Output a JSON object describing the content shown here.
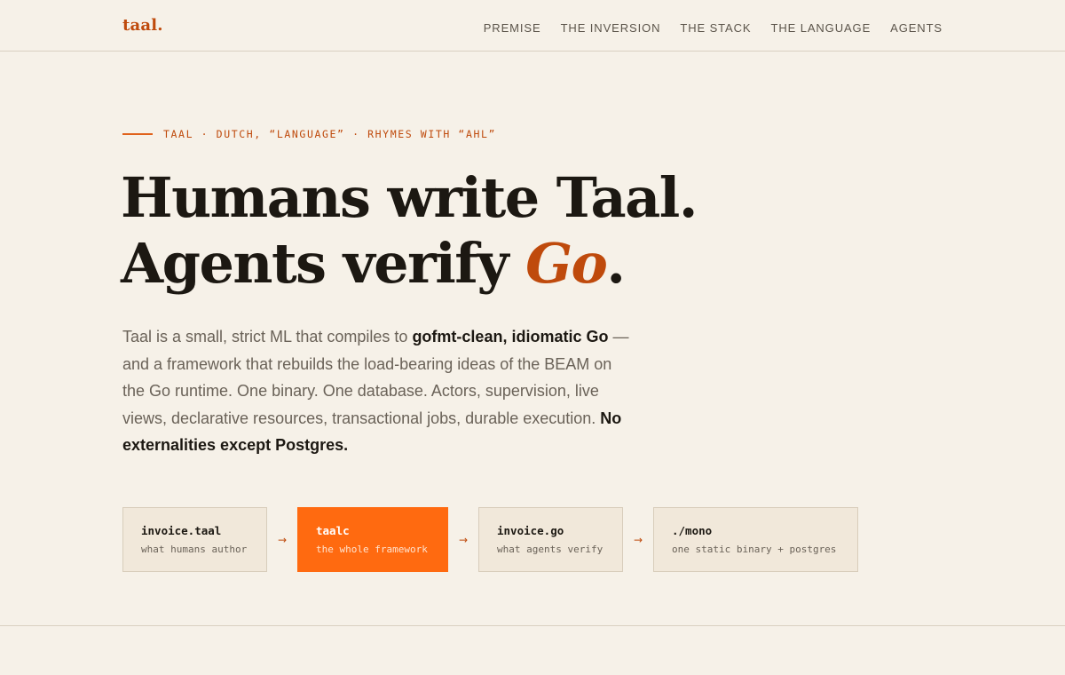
{
  "brand": {
    "name": "taal",
    "dot": ".",
    "accent_color": "#bf4a0c",
    "highlight_color": "#ff6a10",
    "background_color": "#f6f1e8"
  },
  "nav": {
    "items": [
      {
        "label": "PREMISE"
      },
      {
        "label": "THE INVERSION"
      },
      {
        "label": "THE STACK"
      },
      {
        "label": "THE LANGUAGE"
      },
      {
        "label": "AGENTS"
      }
    ]
  },
  "hero": {
    "eyebrow": "TAAL · DUTCH, “LANGUAGE” · RHYMES WITH “AHL”",
    "headline": {
      "line1": "Humans write Taal.",
      "line2_prefix": "Agents verify ",
      "line2_accent": "Go",
      "line2_suffix": "."
    },
    "lede": {
      "part1": "Taal is a small, strict ML that compiles to ",
      "strong1": "gofmt-clean, idiomatic Go",
      "part2": " — and a framework that rebuilds the load-bearing ideas of the BEAM on the Go runtime. One binary. One database. Actors, supervision, live views, declarative resources, transactional jobs, durable execution. ",
      "strong2": "No externalities except Postgres."
    }
  },
  "pipeline": {
    "steps": [
      {
        "title": "invoice.taal",
        "subtitle": "what humans author"
      },
      {
        "title": "taalc",
        "subtitle": "the whole framework"
      },
      {
        "title": "invoice.go",
        "subtitle": "what agents verify"
      },
      {
        "title": "./mono",
        "subtitle": "one static binary + postgres"
      }
    ],
    "arrow": "→"
  }
}
